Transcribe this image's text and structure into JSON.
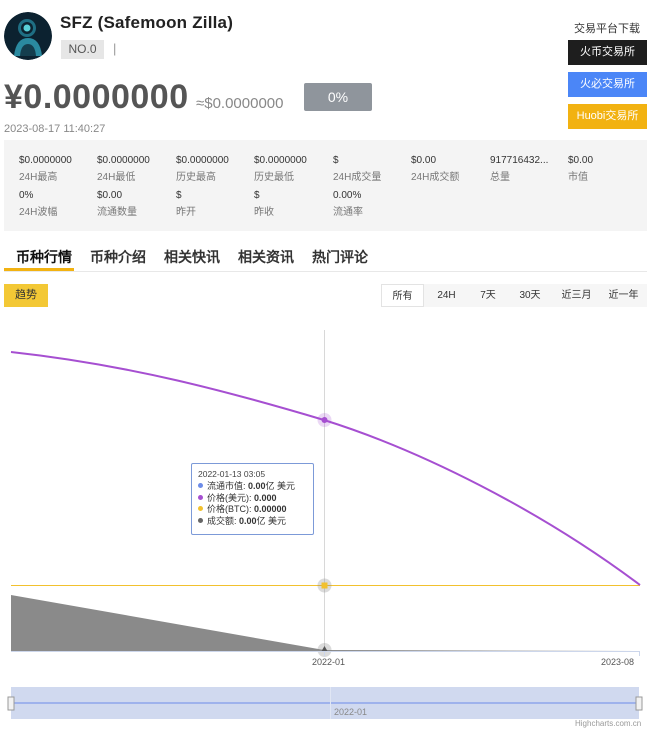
{
  "coin": {
    "title": "SFZ (Safemoon Zilla)",
    "rank": "NO.0",
    "separator": "|",
    "price_cny": "¥0.0000000",
    "price_usd": "≈$0.0000000",
    "change": "0%",
    "timestamp": "2023-08-17 11:40:27"
  },
  "download": {
    "title": "交易平台下载",
    "exchanges": [
      "火币交易所",
      "火必交易所",
      "Huobi交易所"
    ]
  },
  "stats": [
    {
      "value": "$0.0000000",
      "label": "24H最高"
    },
    {
      "value": "$0.0000000",
      "label": "24H最低"
    },
    {
      "value": "$0.0000000",
      "label": "历史最高"
    },
    {
      "value": "$0.0000000",
      "label": "历史最低"
    },
    {
      "value": "$",
      "label": "24H成交量"
    },
    {
      "value": "$0.00",
      "label": "24H成交额"
    },
    {
      "value": "917716432...",
      "label": "总量"
    },
    {
      "value": "$0.00",
      "label": "市值"
    },
    {
      "value": "0%",
      "label": "24H波幅"
    },
    {
      "value": "$0.00",
      "label": "流通数量"
    },
    {
      "value": "$",
      "label": "昨开"
    },
    {
      "value": "$",
      "label": "昨收"
    },
    {
      "value": "0.00%",
      "label": "流通率"
    }
  ],
  "tabs": [
    "币种行情",
    "币种介绍",
    "相关快讯",
    "相关资讯",
    "热门评论"
  ],
  "trend_label": "趋势",
  "ranges": [
    "所有",
    "24H",
    "7天",
    "30天",
    "近三月",
    "近一年"
  ],
  "active_range": "所有",
  "tooltip": {
    "date": "2022-01-13 03:05",
    "rows": [
      {
        "label": "流通市值: ",
        "value": "0.00",
        "unit": "亿 美元",
        "color": "#6d8ce8"
      },
      {
        "label": "价格(美元): ",
        "value": "0.000",
        "unit": "",
        "color": "#a64fd1"
      },
      {
        "label": "价格(BTC): ",
        "value": "0.00000",
        "unit": "",
        "color": "#f2c12e"
      },
      {
        "label": "成交额: ",
        "value": "0.00",
        "unit": "亿 美元",
        "color": "#666666"
      }
    ]
  },
  "chart_data": {
    "type": "line",
    "x_ticks": [
      "2022-01",
      "2023-08"
    ],
    "navigator_label": "2022-01",
    "series": [],
    "colors": {
      "price_usd_line": "#a64fd1",
      "price_btc_line": "#f2c12e",
      "volume_area": "#8a8a8a",
      "crosshair": "#d0d0d0",
      "navigator_fill": "#c8d2ec"
    }
  },
  "credits": "Highcharts.com.cn"
}
